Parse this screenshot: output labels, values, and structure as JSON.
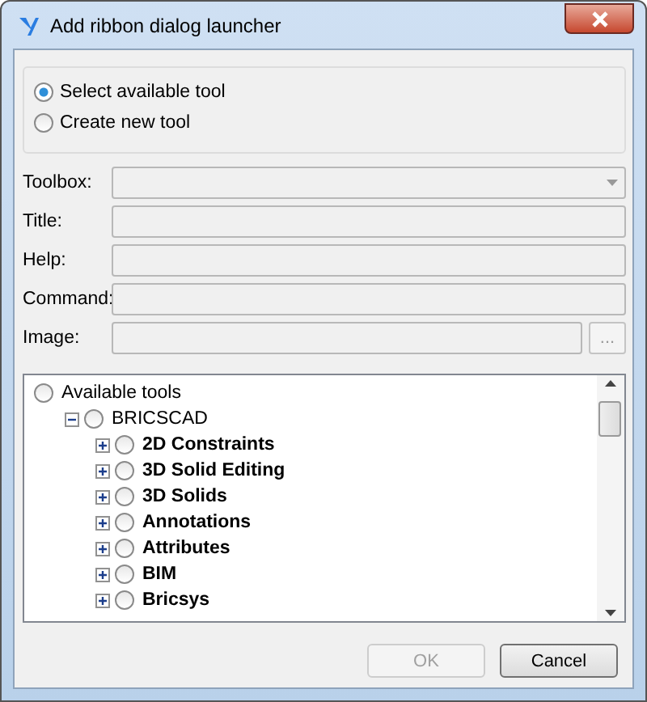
{
  "window": {
    "title": "Add ribbon dialog launcher"
  },
  "mode_options": [
    {
      "label": "Select available tool",
      "selected": true
    },
    {
      "label": "Create new tool",
      "selected": false
    }
  ],
  "fields": [
    {
      "label": "Toolbox:",
      "kind": "dropdown",
      "disabled": true
    },
    {
      "label": "Title:",
      "kind": "text",
      "disabled": true
    },
    {
      "label": "Help:",
      "kind": "text",
      "disabled": true
    },
    {
      "label": "Command:",
      "kind": "text",
      "disabled": true
    },
    {
      "label": "Image:",
      "kind": "browse",
      "disabled": true,
      "button": "..."
    }
  ],
  "tree": [
    {
      "label": "Available tools",
      "selected": false,
      "children": [
        {
          "label": "BRICSCAD",
          "selected": false,
          "expanded": true,
          "children": [
            {
              "label": "2D Constraints",
              "selected": false,
              "expanded": false
            },
            {
              "label": "3D Solid Editing",
              "selected": false,
              "expanded": false
            },
            {
              "label": "3D Solids",
              "selected": false,
              "expanded": false
            },
            {
              "label": "Annotations",
              "selected": false,
              "expanded": false
            },
            {
              "label": "Attributes",
              "selected": false,
              "expanded": false
            },
            {
              "label": "BIM",
              "selected": false,
              "expanded": false
            },
            {
              "label": "Bricsys",
              "selected": false,
              "expanded": false
            }
          ]
        }
      ]
    }
  ],
  "buttons": [
    {
      "label": "OK",
      "disabled": true
    },
    {
      "label": "Cancel",
      "disabled": false
    }
  ]
}
